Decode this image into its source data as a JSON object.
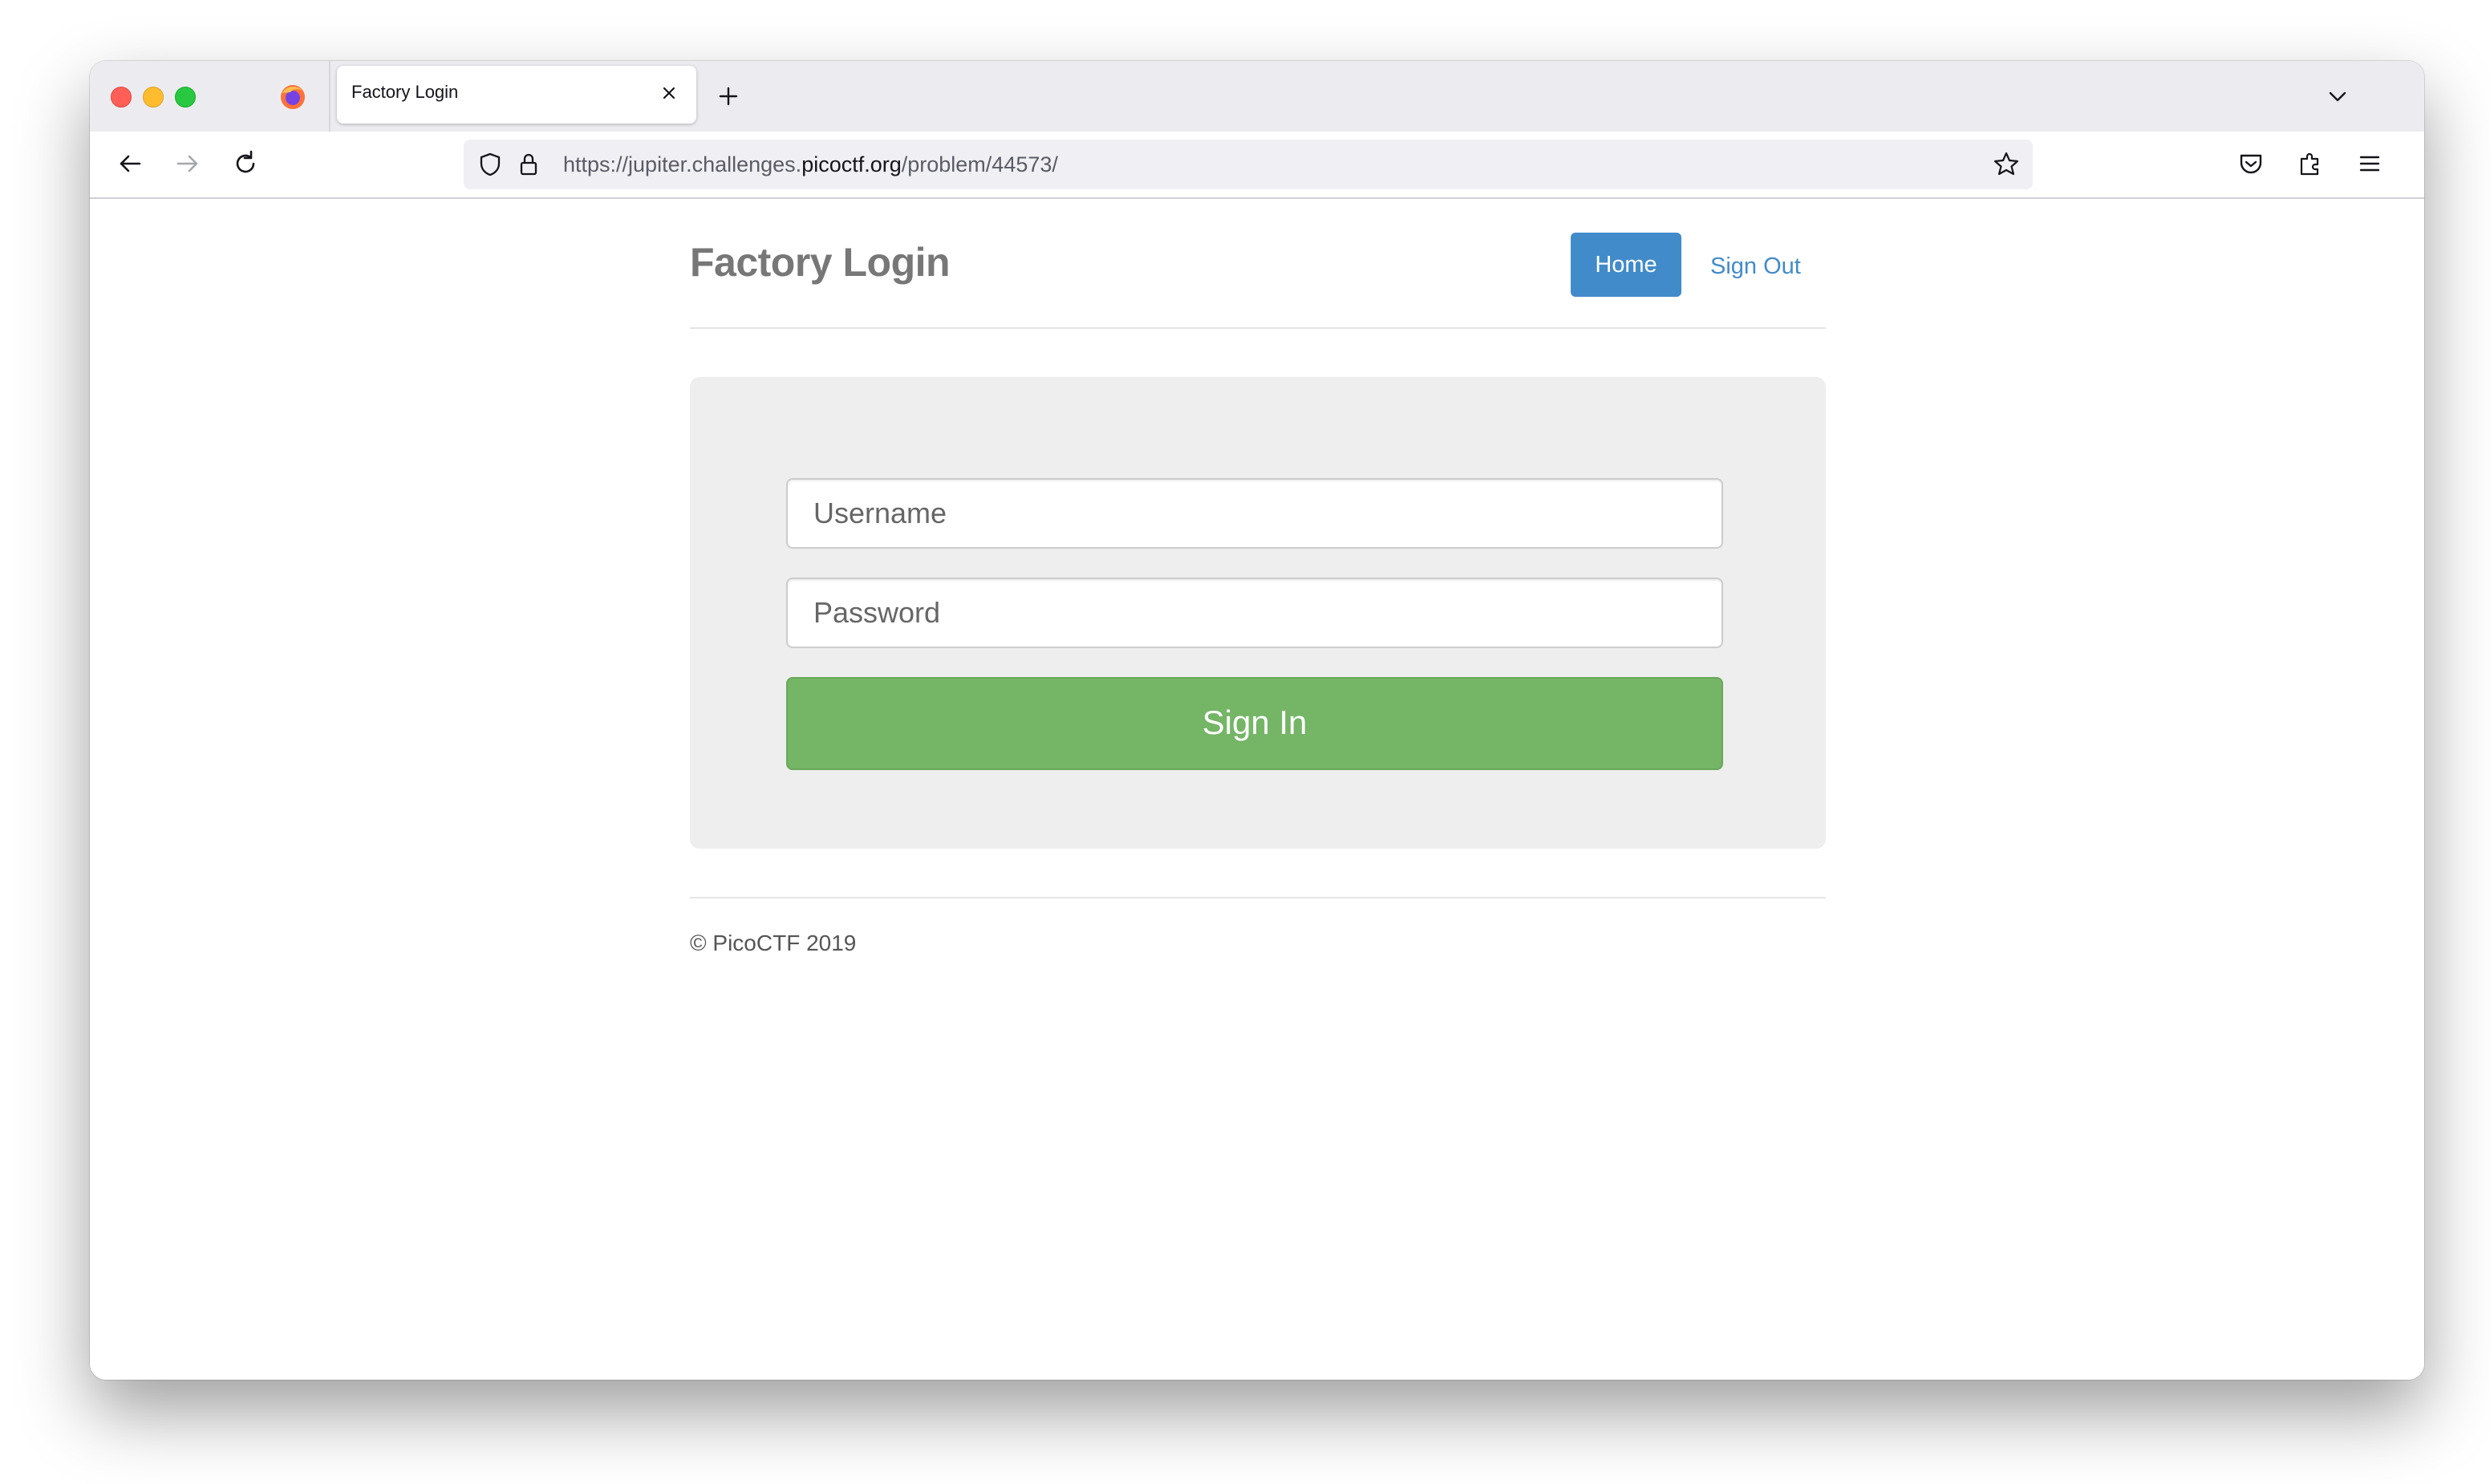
{
  "browser": {
    "tab_title": "Factory Login",
    "url_prefix": "https://jupiter.challenges.",
    "url_domain": "picoctf.org",
    "url_path": "/problem/44573/"
  },
  "page": {
    "site_title": "Factory Login",
    "nav": {
      "home_label": "Home",
      "signout_label": "Sign Out"
    },
    "form": {
      "username_placeholder": "Username",
      "password_placeholder": "Password",
      "signin_label": "Sign In"
    },
    "footer": "© PicoCTF 2019"
  },
  "colors": {
    "primary_button": "#428bca",
    "success_button": "#74b566",
    "jumbotron_bg": "#eeeeee"
  },
  "icons": {
    "back": "arrow-left-icon",
    "forward": "arrow-right-icon",
    "reload": "reload-icon",
    "shield": "shield-icon",
    "lock": "lock-icon",
    "bookmark": "star-icon",
    "pocket": "pocket-icon",
    "extensions": "puzzle-icon",
    "menu": "hamburger-menu-icon"
  }
}
